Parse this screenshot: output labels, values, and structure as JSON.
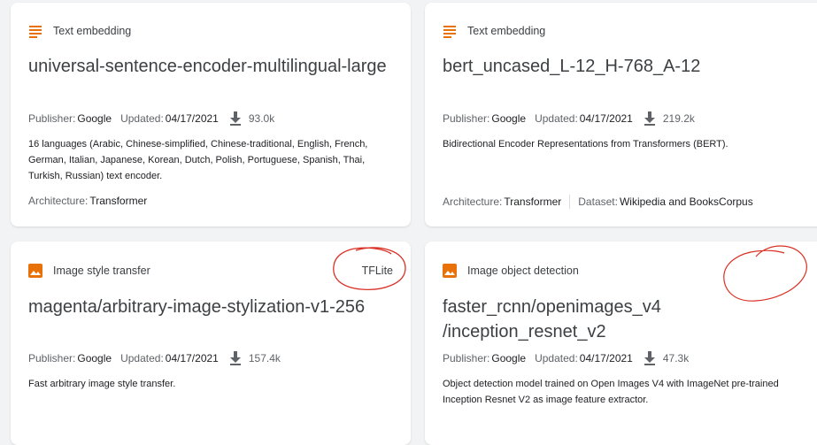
{
  "colors": {
    "accent": "#e8710a",
    "annotation": "#d93025"
  },
  "cards": [
    {
      "category": "Text embedding",
      "category_icon": "text-lines-icon",
      "badge": "",
      "title": "universal-sentence-encoder-multilingual-large",
      "publisher_label": "Publisher:",
      "publisher": "Google",
      "updated_label": "Updated:",
      "updated": "04/17/2021",
      "downloads": "93.0k",
      "description": "16 languages (Arabic, Chinese-simplified, Chinese-traditional, English, French, German, Italian, Japanese, Korean, Dutch, Polish, Portuguese, Spanish, Thai, Turkish, Russian) text encoder.",
      "architecture_label": "Architecture:",
      "architecture": "Transformer"
    },
    {
      "category": "Text embedding",
      "category_icon": "text-lines-icon",
      "badge": "",
      "title": "bert_uncased_L-12_H-768_A-12",
      "publisher_label": "Publisher:",
      "publisher": "Google",
      "updated_label": "Updated:",
      "updated": "04/17/2021",
      "downloads": "219.2k",
      "description": "Bidirectional Encoder Representations from Transformers (BERT).",
      "architecture_label": "Architecture:",
      "architecture": "Transformer",
      "dataset_label": "Dataset:",
      "dataset": "Wikipedia and BooksCorpus"
    },
    {
      "category": "Image style transfer",
      "category_icon": "image-icon",
      "badge": "TFLite",
      "title": "magenta/arbitrary-image-stylization-v1-256",
      "publisher_label": "Publisher:",
      "publisher": "Google",
      "updated_label": "Updated:",
      "updated": "04/17/2021",
      "downloads": "157.4k",
      "description": "Fast arbitrary image style transfer."
    },
    {
      "category": "Image object detection",
      "category_icon": "image-icon",
      "badge": "",
      "title": "faster_rcnn/openimages_v4\n/inception_resnet_v2",
      "publisher_label": "Publisher:",
      "publisher": "Google",
      "updated_label": "Updated:",
      "updated": "04/17/2021",
      "downloads": "47.3k",
      "description": "Object detection model trained on Open Images V4 with ImageNet pre-trained Inception Resnet V2 as image feature extractor."
    }
  ]
}
